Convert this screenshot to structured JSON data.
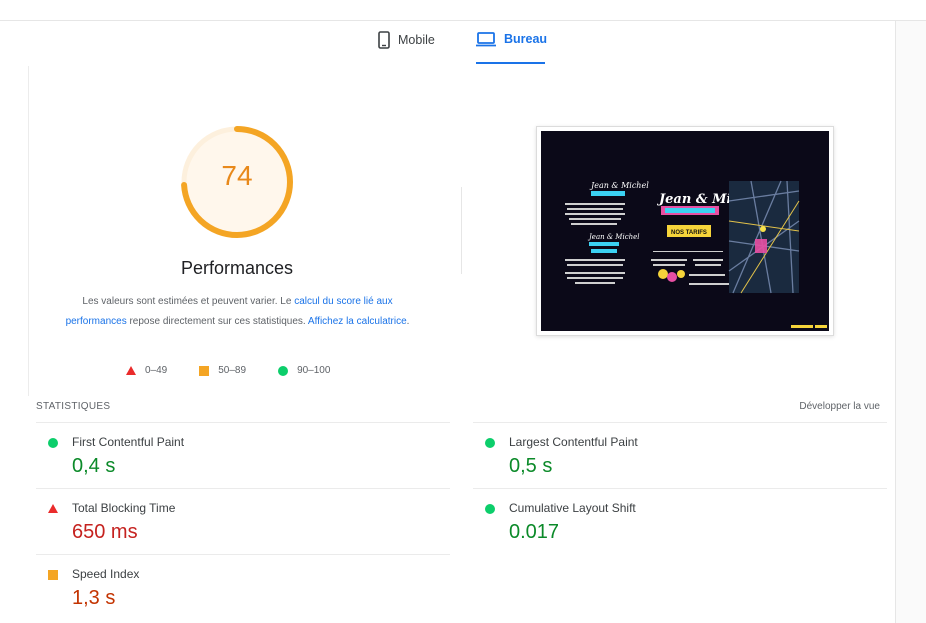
{
  "tabs": {
    "mobile": "Mobile",
    "desktop": "Bureau"
  },
  "score": {
    "value": "74",
    "fraction": 0.74,
    "title": "Performances",
    "note_prefix": "Les valeurs sont estimées et peuvent varier. Le ",
    "note_link1": "calcul du score lié aux performances",
    "note_middle": " repose directement sur ces statistiques. ",
    "note_link2": "Affichez la calculatrice",
    "note_suffix": "."
  },
  "legend": {
    "fail": "0–49",
    "average": "50–89",
    "pass": "90–100"
  },
  "stats": {
    "header": "STATISTIQUES",
    "expand": "Développer la vue",
    "fcp": {
      "label": "First Contentful Paint",
      "value": "0,4 s",
      "status": "pass"
    },
    "lcp": {
      "label": "Largest Contentful Paint",
      "value": "0,5 s",
      "status": "pass"
    },
    "tbt": {
      "label": "Total Blocking Time",
      "value": "650 ms",
      "status": "fail"
    },
    "cls": {
      "label": "Cumulative Layout Shift",
      "value": "0.017",
      "status": "pass"
    },
    "si": {
      "label": "Speed Index",
      "value": "1,3 s",
      "status": "average"
    }
  },
  "screenshot": {
    "brand_left": "Jean & Michel",
    "brand_right": "Jean & Michel",
    "button": "NOS TARIFS"
  },
  "colors": {
    "accent": "#1a73e8",
    "pass": "#0cce6b",
    "average": "#f4a524",
    "fail": "#ea2b2b",
    "gauge": "#f4a524"
  }
}
